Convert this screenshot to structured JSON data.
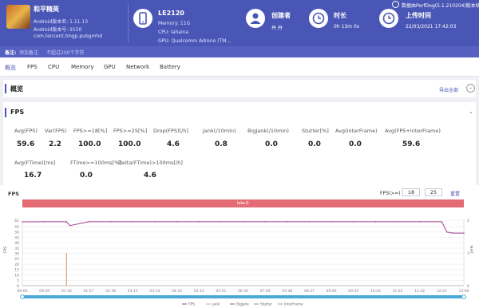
{
  "app": {
    "name": "和平精英",
    "android_version": "Android版本名: 1.11.13",
    "android_code": "Android版本号: 9150",
    "package": "com.tencent.tmgp.pubgmhd"
  },
  "device": {
    "name": "LE2120",
    "memory": "Memory: 11G",
    "cpu": "CPU: lahaina",
    "gpu": "GPU: Qualcomm Adreno (TM..."
  },
  "creator": {
    "label": "创建者",
    "value": "丹 丹"
  },
  "duration": {
    "label": "时长",
    "value": "0h 13m 0s"
  },
  "upload": {
    "label": "上传时间",
    "value": "22/03/2021 17:42:03"
  },
  "source": "数据由PerfDog(5.1.210204)版本收集",
  "note": {
    "label": "备注:",
    "add": "添加备注",
    "hint": "不超过200个字符"
  },
  "tabs": [
    "概览",
    "FPS",
    "CPU",
    "Memory",
    "GPU",
    "Network",
    "Battery"
  ],
  "overview": {
    "title": "概览",
    "export": "导出全部"
  },
  "fps_section": {
    "title": "FPS",
    "row1": [
      {
        "label": "Avg(FPS)",
        "value": "59.6"
      },
      {
        "label": "Var(FPS)",
        "value": "2.2"
      },
      {
        "label": "FPS>=18[%]",
        "value": "100.0"
      },
      {
        "label": "FPS>=25[%]",
        "value": "100.0"
      },
      {
        "label": "Drop(FPS)[/h]",
        "value": "4.6"
      },
      {
        "label": "Jank(/10min)",
        "value": "0.8"
      },
      {
        "label": "BigJank(/10min)",
        "value": "0.0"
      },
      {
        "label": "Stutter[%]",
        "value": "0.0"
      },
      {
        "label": "Avg(InterFrame)",
        "value": "0.0"
      },
      {
        "label": "Avg(FPS+InterFrame)",
        "value": "59.6"
      }
    ],
    "row2": [
      {
        "label": "Avg(FTime)[ms]",
        "value": "16.7"
      },
      {
        "label": "FTime>=100ms[%]",
        "value": "0.0"
      },
      {
        "label": "Delta(FTime)>100ms[/h]",
        "value": "4.6"
      }
    ]
  },
  "chart_section": {
    "title": "FPS",
    "threshold_label": "FPS(>=)",
    "threshold1": "18",
    "threshold2": "25",
    "reset": "重置",
    "label_bar": "label1"
  },
  "chart_data": {
    "type": "line",
    "y_left_ticks": [
      "61",
      "55",
      "50",
      "45",
      "40",
      "35",
      "30",
      "25",
      "20",
      "15",
      "10",
      "5",
      "0"
    ],
    "y_right_ticks": [
      "2",
      "1",
      "0"
    ],
    "y_left_label": "FPS",
    "y_right_label": "Jank",
    "x_ticks": [
      "00:00",
      "00:39",
      "01:18",
      "01:57",
      "02:36",
      "03:15",
      "03:54",
      "04:33",
      "05:12",
      "05:51",
      "06:30",
      "07:09",
      "07:48",
      "08:27",
      "09:06",
      "09:45",
      "10:24",
      "11:03",
      "11:42",
      "12:21",
      "13:00"
    ],
    "ylim": [
      0,
      61
    ],
    "series": [
      {
        "name": "FPS",
        "color": "#a04090",
        "x": [
          "00:00",
          "00:39",
          "01:18",
          "01:24",
          "01:57",
          "02:36",
          "03:15",
          "03:54",
          "04:33",
          "05:12",
          "05:51",
          "06:30",
          "07:09",
          "07:48",
          "08:27",
          "09:06",
          "09:45",
          "10:24",
          "11:03",
          "11:42",
          "12:21",
          "12:30",
          "12:40",
          "13:00"
        ],
        "values": [
          59.5,
          59.6,
          59.6,
          56,
          59.6,
          59.6,
          59.6,
          59.6,
          59.6,
          59.6,
          59.6,
          59.6,
          59.6,
          59.6,
          59.6,
          59.6,
          59.6,
          59.6,
          59.6,
          59.6,
          59.6,
          50,
          49,
          49
        ]
      },
      {
        "name": "Jank",
        "color": "#e0a070",
        "x": [
          "01:18"
        ],
        "values": [
          1
        ]
      }
    ],
    "legend": [
      "FPS",
      "Jank",
      "BigJank",
      "Stutter",
      "InterFrame"
    ],
    "legend_colors": [
      "#a04090",
      "#e0a070",
      "#8a6a4a",
      "#7aa070",
      "#9a9aa0"
    ]
  }
}
